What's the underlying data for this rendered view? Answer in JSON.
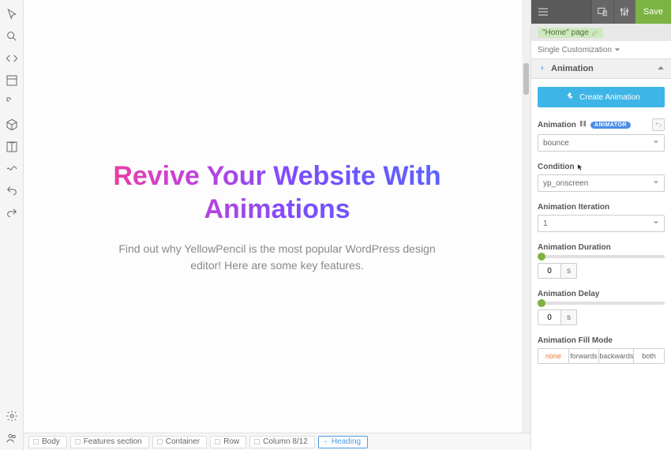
{
  "leftTools": [
    "cursor",
    "search",
    "code",
    "layout",
    "grid",
    "box",
    "text",
    "wave",
    "undo",
    "redo"
  ],
  "bottomTools": [
    "settings",
    "users"
  ],
  "hero": {
    "title": "Revive Your Website With Animations",
    "subtitle": "Find out why YellowPencil is the most popular WordPress design editor! Here are some key features."
  },
  "breadcrumb": [
    "Body",
    "Features section",
    "Container",
    "Row",
    "Column 8/12",
    "Heading"
  ],
  "topbar": {
    "save": "Save"
  },
  "page_badge": "\"Home\" page",
  "customization_mode": "Single Customization",
  "section": {
    "title": "Animation"
  },
  "create_btn": "Create Animation",
  "animation": {
    "label": "Animation",
    "badge": "ANIMATOR",
    "value": "bounce"
  },
  "condition": {
    "label": "Condition",
    "value": "yp_onscreen"
  },
  "iteration": {
    "label": "Animation Iteration",
    "value": "1"
  },
  "duration": {
    "label": "Animation Duration",
    "value": "0",
    "unit": "s"
  },
  "delay": {
    "label": "Animation Delay",
    "value": "0",
    "unit": "s"
  },
  "fillmode": {
    "label": "Animation Fill Mode",
    "options": [
      "none",
      "forwards",
      "backwards",
      "both"
    ],
    "selected": "none"
  }
}
